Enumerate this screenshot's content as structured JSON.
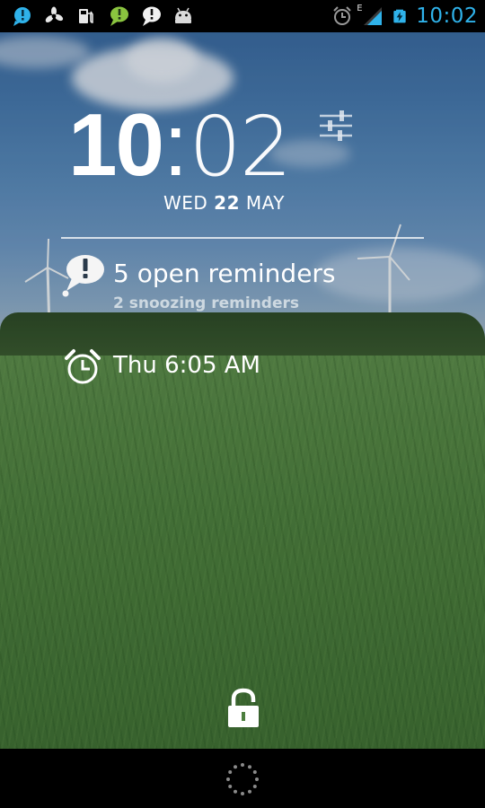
{
  "status_bar": {
    "left_icons": [
      "chat-bubble-icon",
      "cooling-fan-icon",
      "gas-pump-icon",
      "green-alert-bubble-icon",
      "white-alert-bubble-icon",
      "android-robot-icon"
    ],
    "right_icons": [
      "alarm-clock-icon",
      "signal-strength-icon",
      "battery-charging-icon"
    ],
    "network_type": "E",
    "time": "10:02",
    "time_color": "#2fb2ea"
  },
  "lockscreen": {
    "clock": {
      "hour": "10",
      "colon": ":",
      "minute": "02"
    },
    "date": {
      "day_name": "WED",
      "day_number": "22",
      "month": "MAY"
    },
    "settings_icon": "sliders-icon",
    "reminders": {
      "title": "5 open reminders",
      "subtitle": "2 snoozing reminders",
      "icon": "reminder-bubble-icon"
    },
    "alarm": {
      "text": "Thu 6:05 AM",
      "icon": "alarm-clock-icon"
    },
    "unlock_icon": "padlock-icon"
  },
  "nav_bar": {
    "icon": "loading-spinner-icon"
  }
}
